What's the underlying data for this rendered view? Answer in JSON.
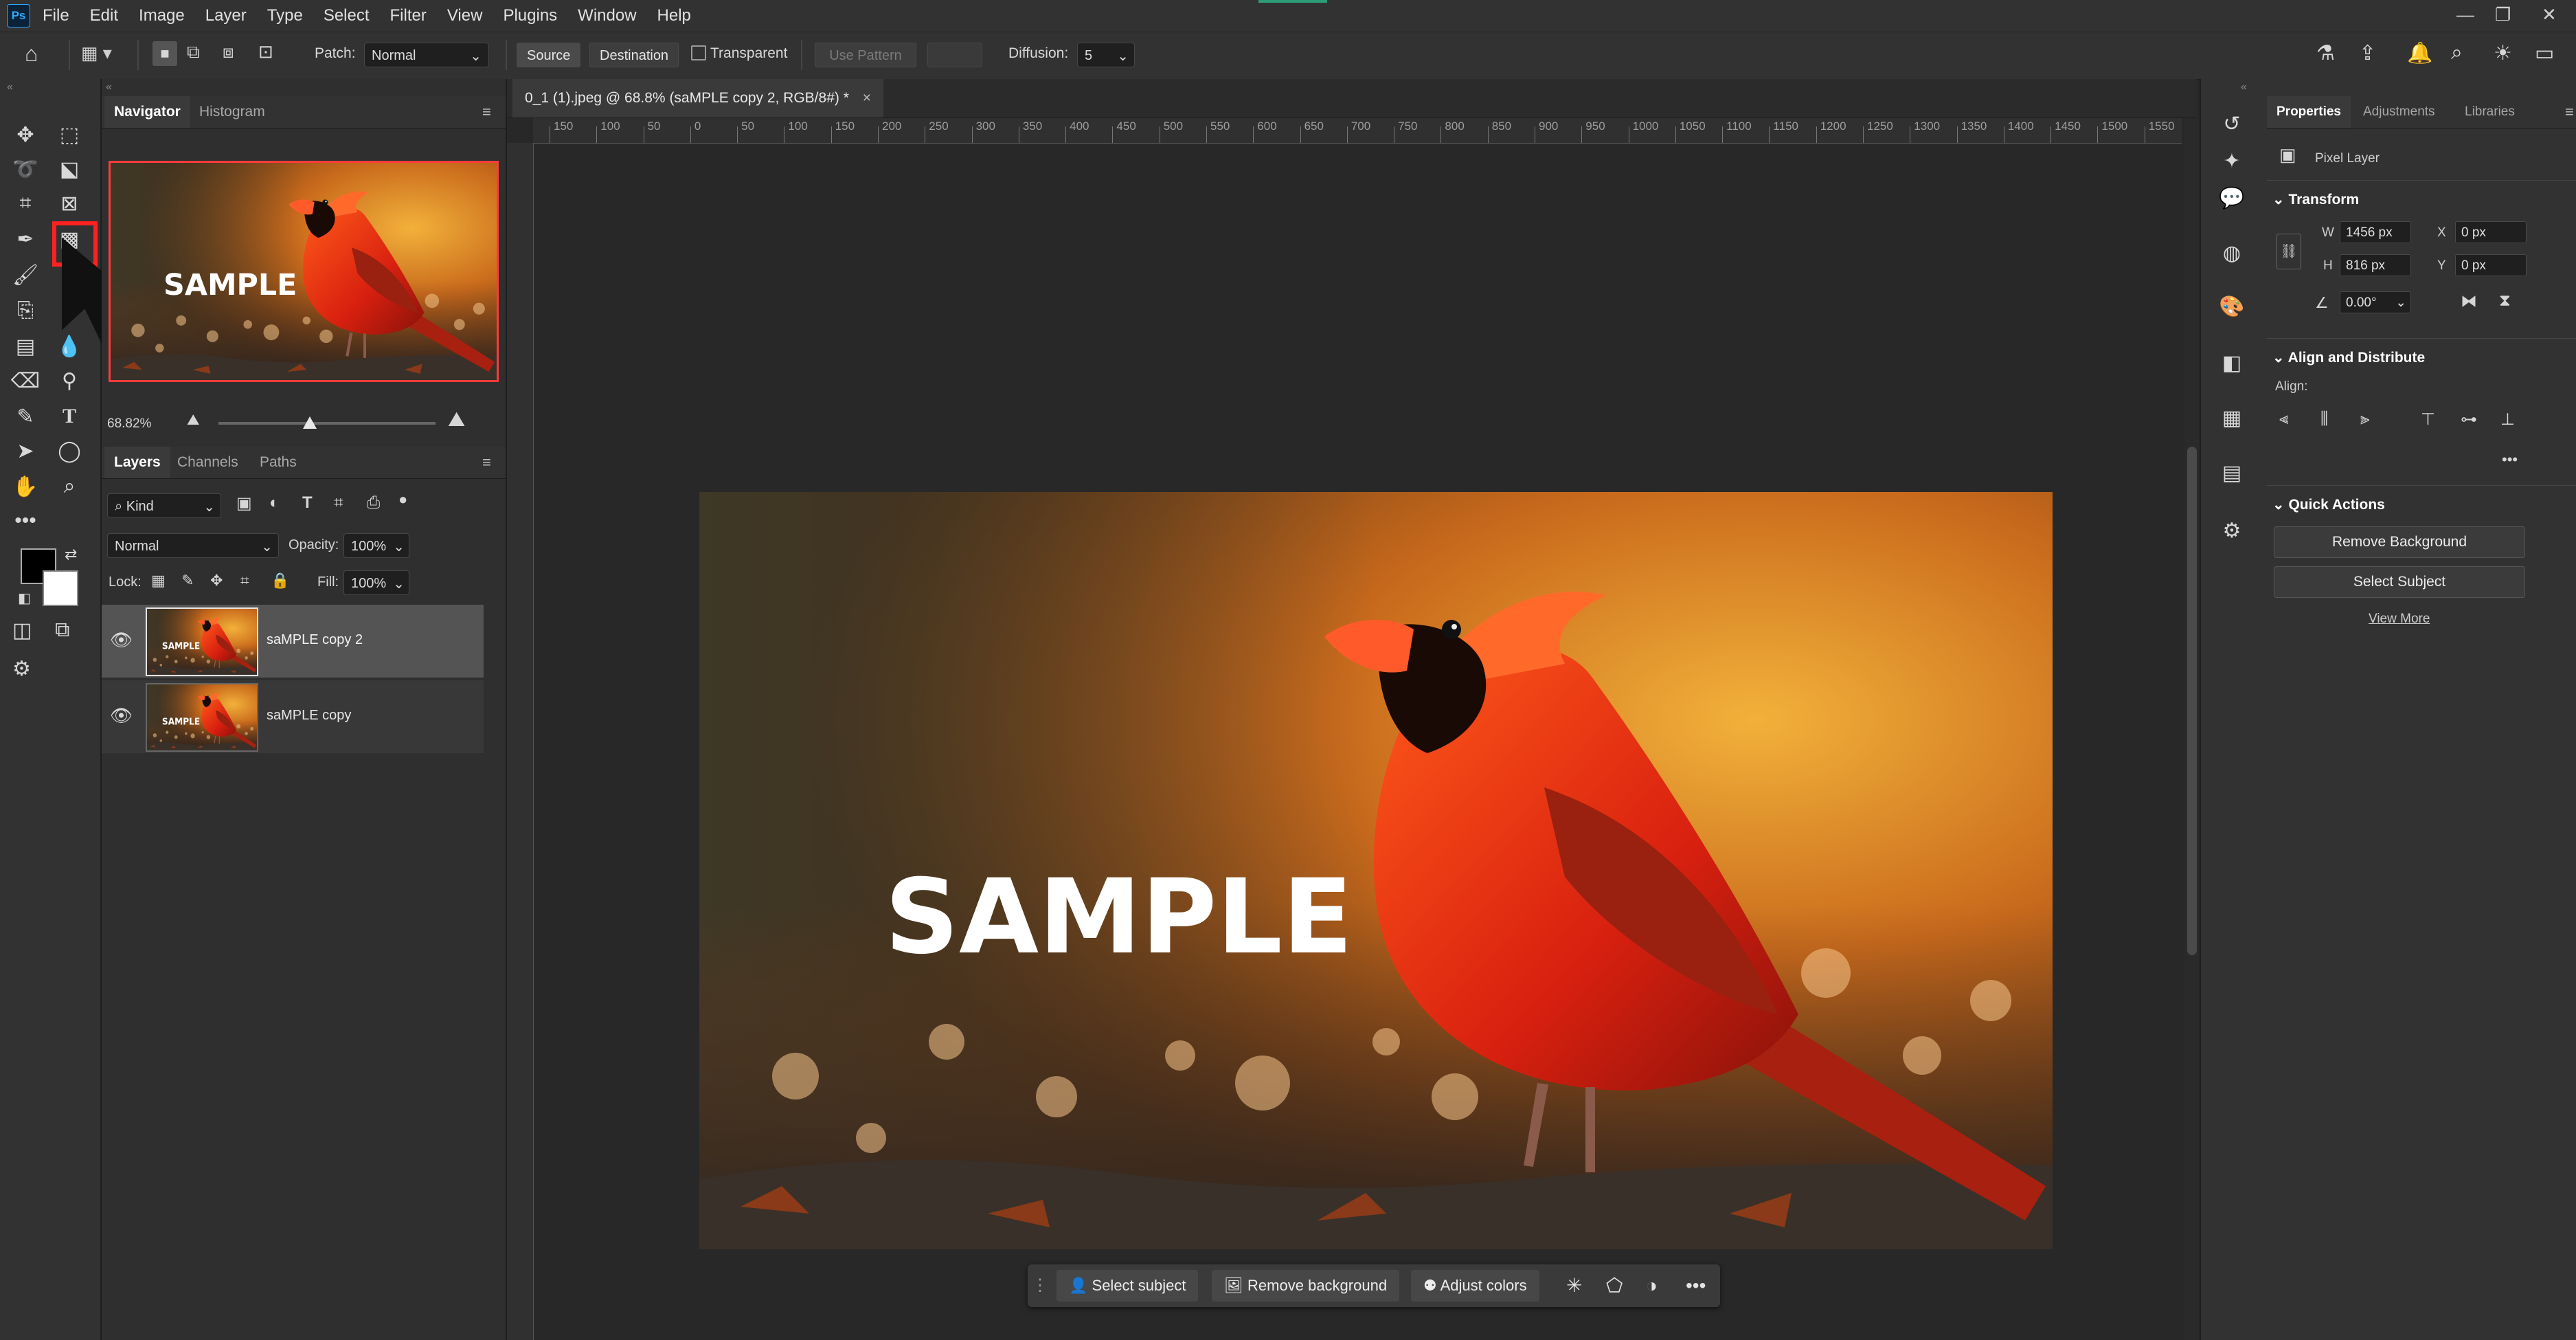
{
  "app": {
    "logo": "Ps",
    "accent_color": "#31a8ff"
  },
  "menu": [
    "File",
    "Edit",
    "Image",
    "Layer",
    "Type",
    "Select",
    "Filter",
    "View",
    "Plugins",
    "Window",
    "Help"
  ],
  "window_controls": [
    "—",
    "❐",
    "✕"
  ],
  "options": {
    "patch_label": "Patch:",
    "patch_mode": "Normal",
    "source": "Source",
    "destination": "Destination",
    "transparent": "Transparent",
    "use_pattern": "Use Pattern",
    "diffusion_label": "Diffusion:",
    "diffusion_value": "5"
  },
  "navigator": {
    "tabs": [
      "Navigator",
      "Histogram"
    ],
    "zoom": "68.82%",
    "slider_level": 0.42
  },
  "layers_panel": {
    "tabs": [
      "Layers",
      "Channels",
      "Paths"
    ],
    "filter_kind": "Kind",
    "blend_mode": "Normal",
    "opacity_label": "Opacity:",
    "opacity": "100%",
    "lock_label": "Lock:",
    "fill_label": "Fill:",
    "fill": "100%",
    "layers": [
      {
        "name": "saMPLE copy 2",
        "selected": true
      },
      {
        "name": "saMPLE copy",
        "selected": false
      }
    ]
  },
  "document": {
    "tab_title": "0_1 (1).jpeg @ 68.8% (saMPLE copy 2, RGB/8#) *",
    "ruler_ticks": [
      "150",
      "100",
      "50",
      "0",
      "50",
      "100",
      "150",
      "200",
      "250",
      "300",
      "350",
      "400",
      "450",
      "500",
      "550",
      "600",
      "650",
      "700",
      "750",
      "800",
      "850",
      "900",
      "950",
      "1000",
      "1050",
      "1100",
      "1150",
      "1200",
      "1250",
      "1300",
      "1350",
      "1400",
      "1450",
      "1500",
      "1550"
    ],
    "watermark_text": "SAMPLE"
  },
  "context_bar": {
    "select_subject": "Select subject",
    "remove_background": "Remove background",
    "adjust_colors": "Adjust colors"
  },
  "properties": {
    "tabs": [
      "Properties",
      "Adjustments",
      "Libraries"
    ],
    "layer_type": "Pixel Layer",
    "transform_head": "Transform",
    "w_label": "W",
    "w": "1456 px",
    "h_label": "H",
    "h": "816 px",
    "x_label": "X",
    "x": "0 px",
    "y_label": "Y",
    "y": "0 px",
    "angle": "0.00°",
    "align_head": "Align and Distribute",
    "align_label": "Align:",
    "quick_head": "Quick Actions",
    "remove_bg": "Remove Background",
    "select_subject": "Select Subject",
    "view_more": "View More"
  }
}
